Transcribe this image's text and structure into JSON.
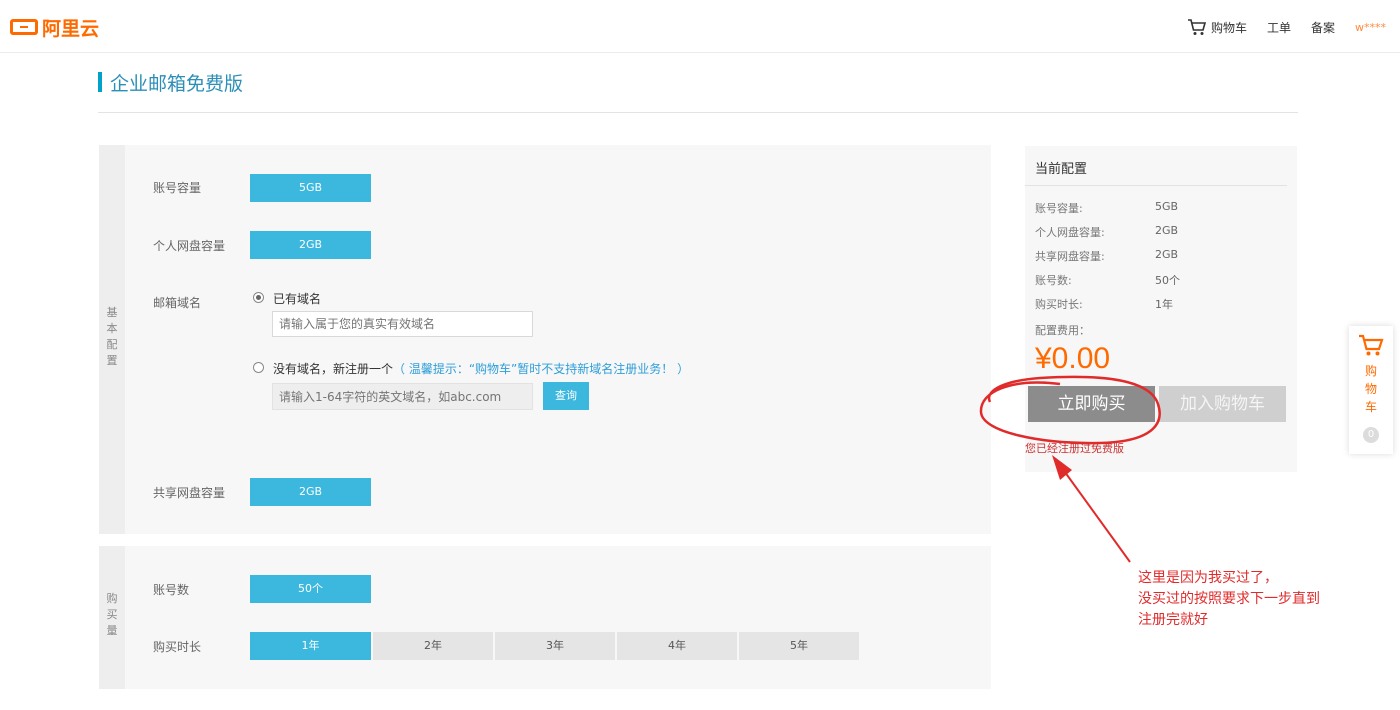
{
  "header": {
    "logo_text": "阿里云",
    "nav": {
      "cart": "购物车",
      "ticket": "工单",
      "record": "备案",
      "user": "w****"
    }
  },
  "page": {
    "title": "企业邮箱免费版"
  },
  "basic": {
    "side_label": [
      "基",
      "本",
      "配",
      "置"
    ],
    "account_capacity": {
      "label": "账号容量",
      "value": "5GB"
    },
    "personal_disk": {
      "label": "个人网盘容量",
      "value": "2GB"
    },
    "domain": {
      "label": "邮箱域名",
      "has_domain_label": "已有域名",
      "has_domain_placeholder": "请输入属于您的真实有效域名",
      "no_domain_label": "没有域名，新注册一个",
      "no_domain_hint": "（ 温馨提示：“购物车”暂时不支持新域名注册业务！ ）",
      "new_domain_placeholder": "请输入1-64字符的英文域名，如abc.com",
      "query_button": "查询"
    },
    "shared_disk": {
      "label": "共享网盘容量",
      "value": "2GB"
    }
  },
  "purchase": {
    "side_label": [
      "购",
      "买",
      "量"
    ],
    "account_count": {
      "label": "账号数",
      "value": "50个"
    },
    "duration": {
      "label": "购买时长",
      "options": [
        "1年",
        "2年",
        "3年",
        "4年",
        "5年"
      ],
      "selected": "1年"
    }
  },
  "summary": {
    "title": "当前配置",
    "rows": [
      {
        "label": "账号容量:",
        "value": "5GB"
      },
      {
        "label": "个人网盘容量:",
        "value": "2GB"
      },
      {
        "label": "共享网盘容量:",
        "value": "2GB"
      },
      {
        "label": "账号数:",
        "value": "50个"
      },
      {
        "label": "购买时长:",
        "value": "1年"
      }
    ],
    "fee_label": "配置费用：",
    "price": "¥0.00",
    "buy_button": "立即购买",
    "cart_button": "加入购物车",
    "registered_notice": "您已经注册过免费版"
  },
  "float_cart": {
    "chars": [
      "购",
      "物",
      "车"
    ],
    "count": "0"
  },
  "annotation": {
    "lines": [
      "这里是因为我买过了，",
      "没买过的按照要求下一步直到",
      "注册完就好"
    ],
    "color": "#e02b2b"
  },
  "colors": {
    "accent": "#3cb7de",
    "brand": "#ff6a00",
    "title": "#2c8fb8"
  }
}
